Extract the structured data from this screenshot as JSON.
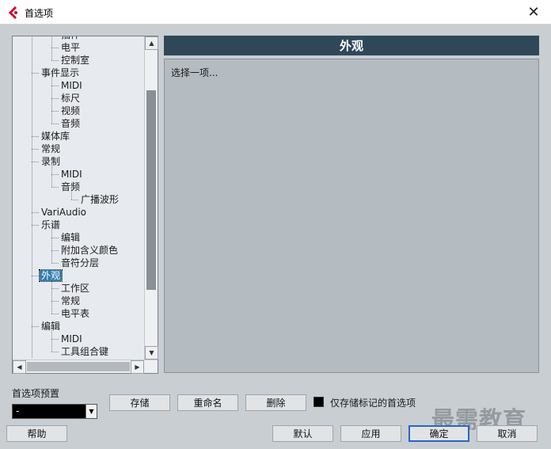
{
  "window": {
    "title": "首选项",
    "close_glyph": "✕",
    "icon": "cubase-logo-icon"
  },
  "tree": {
    "items": [
      {
        "label": "插件",
        "level": 2
      },
      {
        "label": "电平",
        "level": 2
      },
      {
        "label": "控制室",
        "level": 2
      },
      {
        "label": "事件显示",
        "level": 1
      },
      {
        "label": "MIDI",
        "level": 2
      },
      {
        "label": "标尺",
        "level": 2
      },
      {
        "label": "视频",
        "level": 2
      },
      {
        "label": "音频",
        "level": 2
      },
      {
        "label": "媒体库",
        "level": 1
      },
      {
        "label": "常规",
        "level": 1
      },
      {
        "label": "录制",
        "level": 1
      },
      {
        "label": "MIDI",
        "level": 2
      },
      {
        "label": "音频",
        "level": 2
      },
      {
        "label": "广播波形",
        "level": 3
      },
      {
        "label": "VariAudio",
        "level": 1
      },
      {
        "label": "乐谱",
        "level": 1
      },
      {
        "label": "编辑",
        "level": 2
      },
      {
        "label": "附加含义颜色",
        "level": 2
      },
      {
        "label": "音符分层",
        "level": 2
      },
      {
        "label": "外观",
        "level": 1,
        "selected": true
      },
      {
        "label": "工作区",
        "level": 2
      },
      {
        "label": "常规",
        "level": 2
      },
      {
        "label": "电平表",
        "level": 2
      },
      {
        "label": "编辑",
        "level": 1
      },
      {
        "label": "MIDI",
        "level": 2
      },
      {
        "label": "工具组合键",
        "level": 2
      }
    ]
  },
  "panel": {
    "header": "外观",
    "body_text": "选择一项..."
  },
  "presets": {
    "label": "首选项预置",
    "value": "-"
  },
  "buttons": {
    "store": "存储",
    "rename": "重命名",
    "delete": "删除",
    "help": "帮助",
    "defaults": "默认",
    "apply": "应用",
    "ok": "确定",
    "cancel": "取消"
  },
  "checkbox": {
    "label": "仅存储标记的首选项",
    "checked": false
  },
  "watermark": "最需教育",
  "colors": {
    "header_bg": "#2f4858",
    "selection": "#2f7fb0",
    "panel_bg": "#b4bcc2"
  }
}
